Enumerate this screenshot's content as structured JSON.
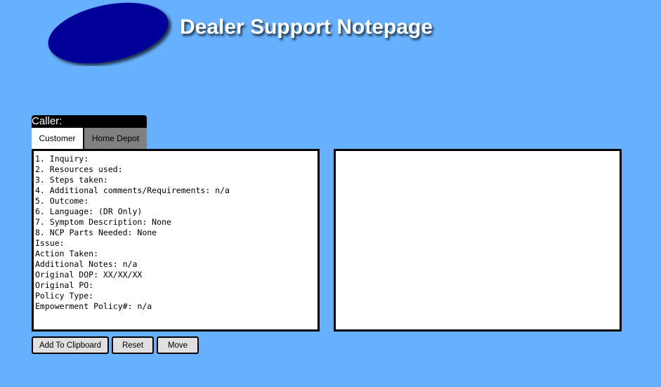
{
  "header": {
    "title": "Dealer Support Notepage",
    "logo_color": "#000099"
  },
  "caller": {
    "label": "Caller:",
    "tabs": [
      {
        "label": "Customer",
        "selected": true
      },
      {
        "label": "Home Depot",
        "selected": false
      }
    ]
  },
  "notes": {
    "left_text": "1. Inquiry:\n2. Resources used:\n3. Steps taken:\n4. Additional comments/Requirements: n/a\n5. Outcome:\n6. Language: (DR Only)\n7. Symptom Description: None\n8. NCP Parts Needed: None\nIssue:\nAction Taken:\nAdditional Notes: n/a\nOriginal DOP: XX/XX/XX\nOriginal PO:\nPolicy Type:\nEmpowerment Policy#: n/a",
    "right_text": ""
  },
  "buttons": {
    "add_to_clipboard": "Add To Clipboard",
    "reset": "Reset",
    "move": "Move"
  },
  "colors": {
    "background": "#66b0fd",
    "tab_selected": "#ffffff",
    "tab_unselected": "#808080"
  }
}
